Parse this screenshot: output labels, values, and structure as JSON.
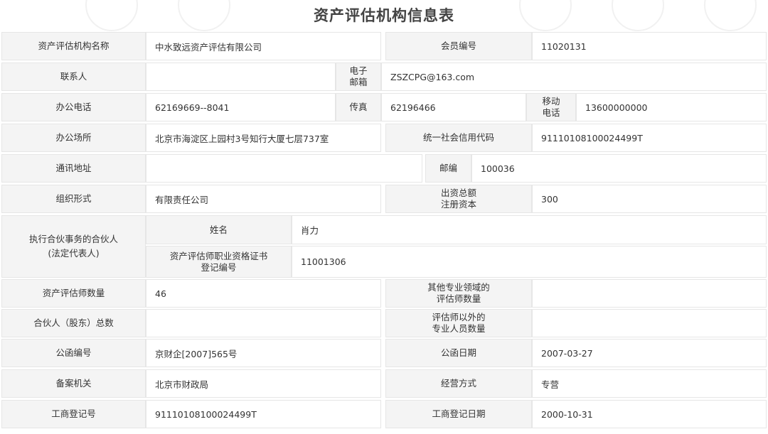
{
  "title": "资产评估机构信息表",
  "rows": {
    "r1": {
      "name_label": "资产评估机构名称",
      "name_value": "中水致远资产评估有限公司",
      "member_label": "会员编号",
      "member_value": "11020131"
    },
    "r2": {
      "contact_label": "联系人",
      "contact_value": "",
      "email_label_1": "电子",
      "email_label_2": "邮箱",
      "email_value": "ZSZCPG@163.com"
    },
    "r3": {
      "phone_label": "办公电话",
      "phone_value": "62169669--8041",
      "fax_label": "传真",
      "fax_value": "62196466",
      "mobile_label_1": "移动",
      "mobile_label_2": "电话",
      "mobile_value": "13600000000"
    },
    "r4": {
      "office_label": "办公场所",
      "office_value": "北京市海淀区上园村3号知行大厦七层737室",
      "credit_label": "统一社会信用代码",
      "credit_value": "91110108100024499T"
    },
    "r5": {
      "address_label": "通讯地址",
      "address_value": "",
      "postcode_label": "邮编",
      "postcode_value": "100036"
    },
    "r6": {
      "org_label": "组织形式",
      "org_value": "有限责任公司",
      "capital_label_1": "出资总额",
      "capital_label_2": "注册资本",
      "capital_value": "300"
    },
    "r7": {
      "partner_label_1": "执行合伙事务的合伙人",
      "partner_label_2": "(法定代表人)",
      "pname_label": "姓名",
      "pname_value": "肖力",
      "cert_label_1": "资产评估师职业资格证书",
      "cert_label_2": "登记编号",
      "cert_value": "11001306"
    },
    "r8": {
      "appraiser_label": "资产评估师数量",
      "appraiser_value": "46",
      "other_label_1": "其他专业领域的",
      "other_label_2": "评估师数量",
      "other_value": ""
    },
    "r9": {
      "partners_label": "合伙人（股东）总数",
      "partners_value": "",
      "staff_label_1": "评估师以外的",
      "staff_label_2": "专业人员数量",
      "staff_value": ""
    },
    "r10": {
      "letter_label": "公函编号",
      "letter_value": "京财企[2007]565号",
      "letter_date_label": "公函日期",
      "letter_date_value": "2007-03-27"
    },
    "r11": {
      "filing_label": "备案机关",
      "filing_value": "北京市财政局",
      "mode_label": "经营方式",
      "mode_value": "专营"
    },
    "r12": {
      "reg_label": "工商登记号",
      "reg_value": "91110108100024499T",
      "reg_date_label": "工商登记日期",
      "reg_date_value": "2000-10-31"
    }
  },
  "colors": {
    "label_bg": "#f4f4f4",
    "border": "#e6e6e6",
    "text": "#333333"
  }
}
